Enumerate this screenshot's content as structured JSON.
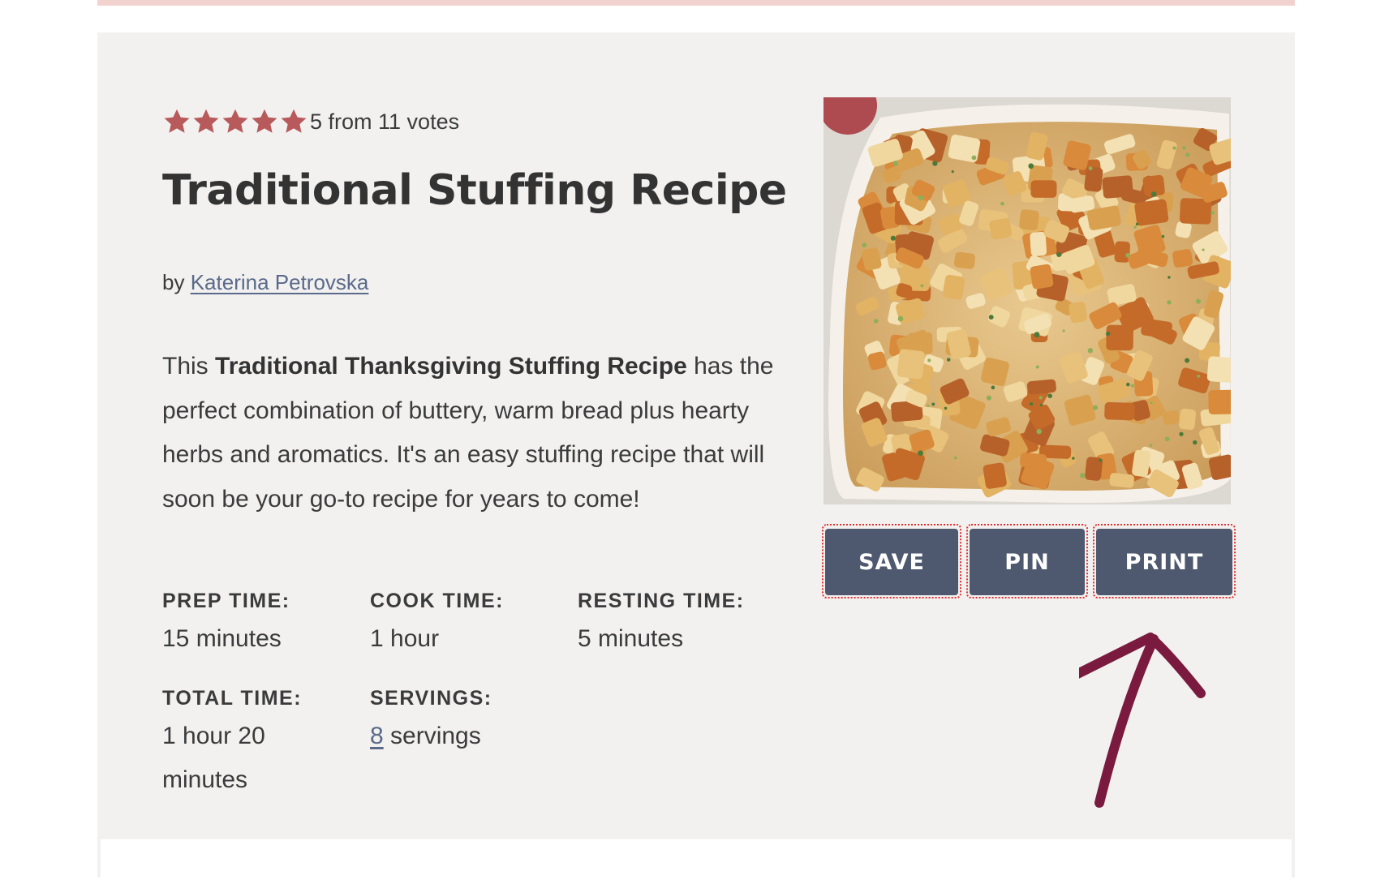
{
  "rating": {
    "value": 5,
    "max": 5,
    "text": "5 from 11 votes",
    "star_color": "#b8595c"
  },
  "recipe": {
    "title": "Traditional Stuffing Recipe",
    "by_prefix": "by",
    "author": "Katerina Petrovska",
    "summary_intro": "This",
    "summary_bold": "Traditional Thanksgiving Stuffing Recipe",
    "summary_rest": " has the perfect combination of buttery, warm bread plus hearty herbs and aromatics. It's an easy stuffing recipe that will soon be your go-to recipe for years to come!"
  },
  "times": {
    "prep_label": "PREP TIME:",
    "prep_value": "15 minutes",
    "cook_label": "COOK TIME:",
    "cook_value": "1 hour",
    "resting_label": "RESTING TIME:",
    "resting_value": "5 minutes",
    "total_label": "TOTAL TIME:",
    "total_value": "1 hour 20 minutes",
    "servings_label": "SERVINGS:",
    "servings_count": "8",
    "servings_unit": "servings"
  },
  "buttons": {
    "save": "SAVE",
    "pin": "PIN",
    "print": "PRINT"
  },
  "colors": {
    "button_bg": "#4e586f",
    "highlight_outline": "#e03030",
    "arrow": "#7a1a3e",
    "link": "#5a6a8a",
    "card_bg": "#f2f1f0",
    "top_bar": "#f2d2cf"
  },
  "image": {
    "alt": "stuffing-in-baking-dish-photo"
  }
}
